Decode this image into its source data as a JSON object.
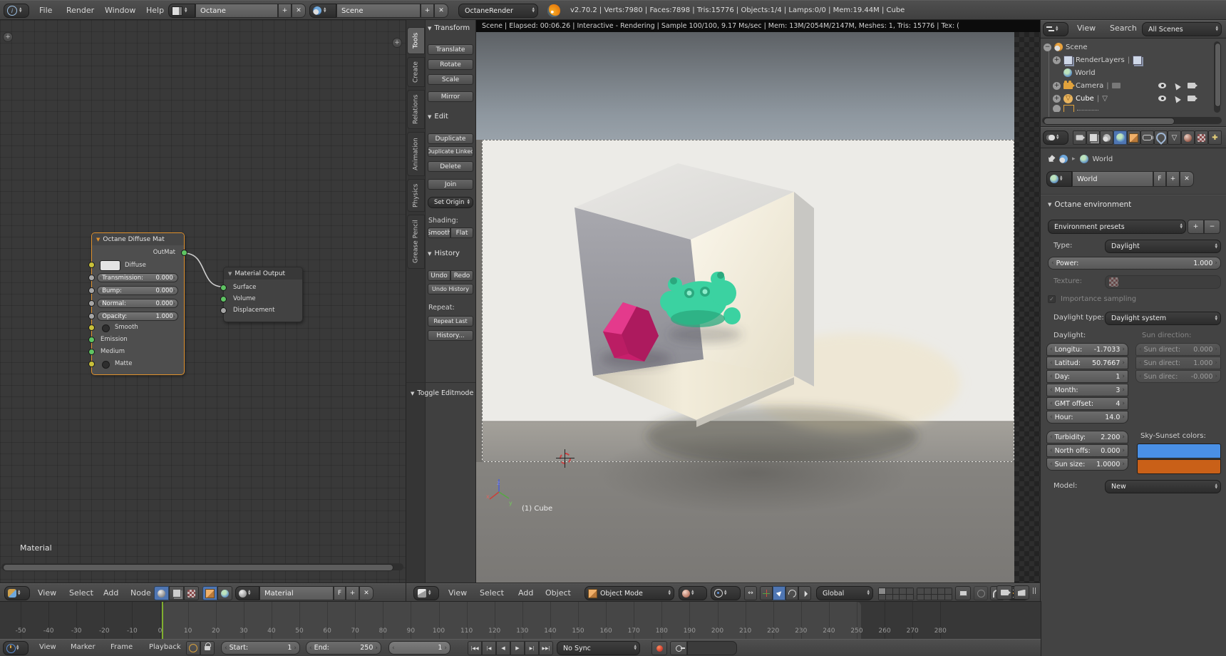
{
  "icons": {
    "collapse": "▼",
    "plus": "+",
    "minus": "−",
    "cross": "✕",
    "check": "✓",
    "tree_plus": "+",
    "tree_minus": "−",
    "pipe": "|",
    "breadcrumb_arrow": "‣",
    "pause_bars": "||"
  },
  "topbar": {
    "menus": [
      "File",
      "Render",
      "Window",
      "Help"
    ],
    "layout_name": "Octane",
    "scene_name": "Scene",
    "engine": "OctaneRender",
    "stats": "v2.70.2 | Verts:7980 | Faces:7898 | Tris:15776 | Objects:1/4 | Lamps:0/0 | Mem:19.44M | Cube"
  },
  "node_editor": {
    "diffuse_node": {
      "title": "Octane Diffuse Mat",
      "out_label": "OutMat",
      "diffuse_label": "Diffuse",
      "fields": [
        {
          "label": "Transmission:",
          "value": "0.000"
        },
        {
          "label": "Bump:",
          "value": "0.000"
        },
        {
          "label": "Normal:",
          "value": "0.000"
        },
        {
          "label": "Opacity:",
          "value": "1.000"
        }
      ],
      "smooth_label": "Smooth",
      "emission_label": "Emission",
      "medium_label": "Medium",
      "matte_label": "Matte"
    },
    "output_node": {
      "title": "Material Output",
      "inputs": [
        "Surface",
        "Volume",
        "Displacement"
      ]
    },
    "frame_label": "Material",
    "header": {
      "menus": [
        "View",
        "Select",
        "Add",
        "Node"
      ],
      "material_name": "Material",
      "fake_user": "F"
    }
  },
  "tool_shelf": {
    "tabs": [
      "Tools",
      "Create",
      "Relations",
      "Animation",
      "Physics",
      "Grease Pencil"
    ],
    "transform_title": "Transform",
    "transform_buttons": [
      "Translate",
      "Rotate",
      "Scale",
      "Mirror"
    ],
    "edit_title": "Edit",
    "edit_buttons": [
      "Duplicate",
      "Duplicate Linked",
      "Delete",
      "Join"
    ],
    "set_origin": "Set Origin",
    "shading_label": "Shading:",
    "shading_buttons": [
      "Smooth",
      "Flat"
    ],
    "history_title": "History",
    "undo": "Undo",
    "redo": "Redo",
    "undo_history": "Undo History",
    "repeat_label": "Repeat:",
    "repeat_last": "Repeat Last",
    "history_menu": "History...",
    "operator_panel": "Toggle Editmode"
  },
  "viewport": {
    "render_stats": "Scene | Elapsed: 00:06.26 | Interactive - Rendering | Sample 100/100, 9.17 Ms/sec | Mem: 13M/2054M/2147M, Meshes: 1, Tris: 15776 | Tex: (",
    "object_label": "(1) Cube",
    "axis_labels": {
      "x": "x",
      "y": "y",
      "z": "z"
    },
    "header": {
      "menus": [
        "View",
        "Select",
        "Add",
        "Object"
      ],
      "mode": "Object Mode",
      "orientation": "Global"
    }
  },
  "outliner": {
    "header": {
      "view": "View",
      "search": "Search",
      "scope": "All Scenes"
    },
    "items": [
      "Scene",
      "RenderLayers",
      "World",
      "Camera",
      "Cube"
    ]
  },
  "properties": {
    "breadcrumb": "World",
    "id_name": "World",
    "fake_user": "F",
    "panel_title": "Octane environment",
    "presets_label": "Environment presets",
    "type_label": "Type:",
    "type_value": "Daylight",
    "power_label": "Power:",
    "power_value": "1.000",
    "texture_label": "Texture:",
    "importance_label": "Importance sampling",
    "daylight_type_label": "Daylight type:",
    "daylight_type_value": "Daylight system",
    "daylight_label": "Daylight:",
    "sun_direction_label": "Sun direction:",
    "daylight_fields": [
      {
        "label": "Longitu:",
        "value": "-1.7033"
      },
      {
        "label": "Latitud:",
        "value": "50.7667"
      },
      {
        "label": "Day:",
        "value": "1"
      },
      {
        "label": "Month:",
        "value": "3"
      },
      {
        "label": "GMT offset:",
        "value": "4"
      },
      {
        "label": "Hour:",
        "value": "14.0"
      }
    ],
    "sun_fields": [
      {
        "label": "Sun direct:",
        "value": "0.000"
      },
      {
        "label": "Sun direct:",
        "value": "1.000"
      },
      {
        "label": "Sun direc:",
        "value": "-0.000"
      }
    ],
    "sky_fields": [
      {
        "label": "Turbidity:",
        "value": "2.200"
      },
      {
        "label": "North offs:",
        "value": "0.000"
      },
      {
        "label": "Sun size:",
        "value": "1.0000"
      }
    ],
    "sky_colors_label": "Sky-Sunset colors:",
    "sky_colors": {
      "sky": "#4a90e6",
      "sunset": "#c96018"
    },
    "model_label": "Model:",
    "model_value": "New"
  },
  "timeline": {
    "ruler": [
      "-50",
      "-40",
      "-30",
      "-20",
      "-10",
      "0",
      "10",
      "20",
      "30",
      "40",
      "50",
      "60",
      "70",
      "80",
      "90",
      "100",
      "110",
      "120",
      "130",
      "140",
      "150",
      "160",
      "170",
      "180",
      "190",
      "200",
      "210",
      "220",
      "230",
      "240",
      "250",
      "260",
      "270",
      "280"
    ],
    "playback_icons": [
      "|◀◀",
      "|◀",
      "◀",
      "▶",
      "▶|",
      "▶▶|"
    ],
    "header": {
      "menus": [
        "View",
        "Marker",
        "Frame",
        "Playback"
      ],
      "start_label": "Start:",
      "start_value": "1",
      "end_label": "End:",
      "end_value": "250",
      "current_frame": "1",
      "sync_mode": "No Sync"
    }
  },
  "colors": {
    "accent_selected": "#4f76b3",
    "node_active_border": "#e0912d",
    "current_frame_green": "#7fae2f",
    "render_pink": "#c81f6c",
    "render_teal": "#3bd2a1"
  }
}
